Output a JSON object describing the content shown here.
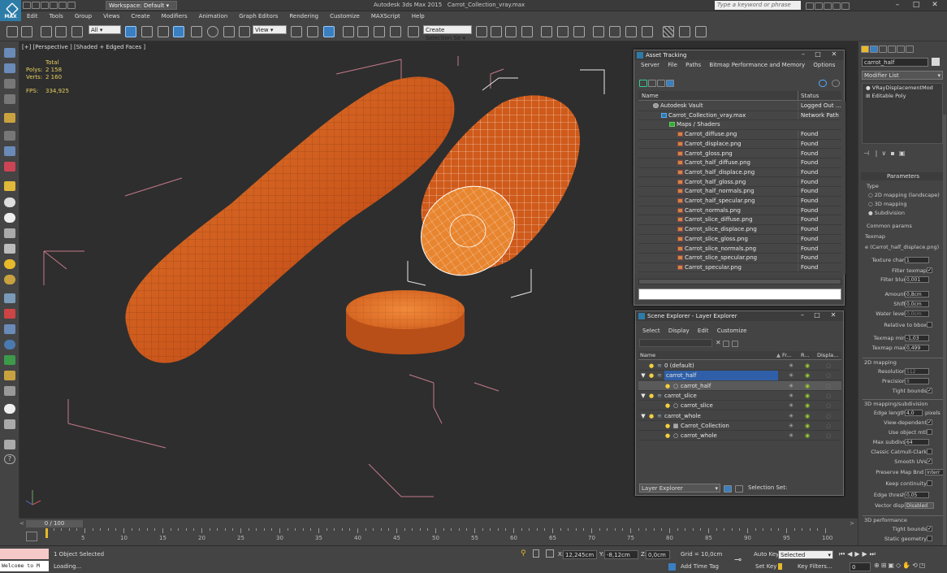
{
  "app": {
    "logo_label": "MAX",
    "title": "Autodesk 3ds Max 2015",
    "file": "Carrot_Collection_vray.max",
    "workspace": "Workspace: Default",
    "search_placeholder": "Type a keyword or phrase"
  },
  "menu": [
    "Edit",
    "Tools",
    "Group",
    "Views",
    "Create",
    "Modifiers",
    "Animation",
    "Graph Editors",
    "Rendering",
    "Customize",
    "MAXScript",
    "Help"
  ],
  "toolbar": {
    "selection_filter": "All",
    "ref_coord": "View",
    "named_selection": "Create Selection Se"
  },
  "viewport": {
    "label": "[+] [Perspective ] [Shaded + Edged Faces ]",
    "stats_total": "Total",
    "polys_label": "Polys:",
    "polys_value": "2 158",
    "verts_label": "Verts:",
    "verts_value": "2 160",
    "fps_label": "FPS:",
    "fps_value": "334,925"
  },
  "asset_tracking": {
    "title": "Asset Tracking",
    "menu": [
      "Server",
      "File",
      "Paths",
      "Bitmap Performance and Memory",
      "Options"
    ],
    "col_name": "Name",
    "col_status": "Status",
    "rows": [
      {
        "name": "Autodesk Vault",
        "status": "Logged Out ..."
      },
      {
        "name": "Carrot_Collection_vray.max",
        "status": "Network Path"
      },
      {
        "name": "Maps / Shaders",
        "status": ""
      },
      {
        "name": "Carrot_diffuse.png",
        "status": "Found"
      },
      {
        "name": "Carrot_displace.png",
        "status": "Found"
      },
      {
        "name": "Carrot_gloss.png",
        "status": "Found"
      },
      {
        "name": "Carrot_half_diffuse.png",
        "status": "Found"
      },
      {
        "name": "Carrot_half_displace.png",
        "status": "Found"
      },
      {
        "name": "Carrot_half_gloss.png",
        "status": "Found"
      },
      {
        "name": "Carrot_half_normals.png",
        "status": "Found"
      },
      {
        "name": "Carrot_half_specular.png",
        "status": "Found"
      },
      {
        "name": "Carrot_normals.png",
        "status": "Found"
      },
      {
        "name": "Carrot_slice_diffuse.png",
        "status": "Found"
      },
      {
        "name": "Carrot_slice_displace.png",
        "status": "Found"
      },
      {
        "name": "Carrot_slice_gloss.png",
        "status": "Found"
      },
      {
        "name": "Carrot_slice_normals.png",
        "status": "Found"
      },
      {
        "name": "Carrot_slice_specular.png",
        "status": "Found"
      },
      {
        "name": "Carrot_specular.png",
        "status": "Found"
      }
    ]
  },
  "scene_explorer": {
    "title": "Scene Explorer - Layer Explorer",
    "menu": [
      "Select",
      "Display",
      "Edit",
      "Customize"
    ],
    "col_name": "Name",
    "col_fr": "Fr...",
    "col_r": "R...",
    "col_disp": "Displa...",
    "rows": [
      {
        "name": "0 (default)",
        "type": "layer",
        "expanded": false,
        "selected": false
      },
      {
        "name": "carrot_half",
        "type": "layer",
        "expanded": true,
        "selected": true
      },
      {
        "name": "carrot_half",
        "type": "object",
        "expanded": false,
        "selected": false
      },
      {
        "name": "carrot_slice",
        "type": "layer",
        "expanded": true,
        "selected": false
      },
      {
        "name": "carrot_slice",
        "type": "object",
        "expanded": false,
        "selected": false
      },
      {
        "name": "carrot_whole",
        "type": "layer",
        "expanded": true,
        "selected": false
      },
      {
        "name": "Carrot_Collection",
        "type": "group",
        "expanded": false,
        "selected": false
      },
      {
        "name": "carrot_whole",
        "type": "object",
        "expanded": false,
        "selected": false
      }
    ],
    "footer_dropdown": "Layer Explorer",
    "selection_set_label": "Selection Set:"
  },
  "command_panel": {
    "object_name": "carrot_half",
    "modifier_list": "Modifier List",
    "stack": [
      "VRayDisplacementMod",
      "Editable Poly"
    ],
    "parameters_title": "Parameters",
    "type_label": "Type",
    "type_options": [
      "2D mapping (landscape)",
      "3D mapping",
      "Subdivision"
    ],
    "type_selected": "Subdivision",
    "common_params": "Common params",
    "texmap_label": "Texmap",
    "texmap_value": "e (Carrot_half_displace.png)",
    "texture_chan_label": "Texture chan",
    "texture_chan_value": "1",
    "filter_texmap_label": "Filter texmap",
    "filter_blur_label": "Filter blur",
    "filter_blur_value": "0,001",
    "amount_label": "Amount",
    "amount_value": "0,8cm",
    "shift_label": "Shift",
    "shift_value": "0,0cm",
    "water_level_label": "Water level",
    "water_level_value": "0,0cm",
    "relative_bbox_label": "Relative to bbox",
    "texmap_min_label": "Texmap min",
    "texmap_min_value": "-1,03",
    "texmap_max_label": "Texmap max",
    "texmap_max_value": "0,499",
    "mapping2d_title": "2D mapping",
    "resolution_label": "Resolution",
    "resolution_value": "512",
    "precision_label": "Precision",
    "precision_value": "8",
    "tight_bounds_label": "Tight bounds",
    "mapping3d_title": "3D mapping/subdivision",
    "edge_length_label": "Edge length",
    "edge_length_value": "4,0",
    "pixels_label": "pixels",
    "view_dependent_label": "View-dependent",
    "use_object_mtl_label": "Use object mtl",
    "max_subdivs_label": "Max subdivs",
    "max_subdivs_value": "64",
    "classic_cc_label": "Classic Catmull-Clark",
    "smooth_uvs_label": "Smooth UVs",
    "preserve_map_label": "Preserve Map Bnd",
    "preserve_map_value": "Interr",
    "keep_continuity_label": "Keep continuity",
    "edge_thresh_label": "Edge thresh",
    "edge_thresh_value": "0,05",
    "vector_displ_label": "Vector displ",
    "vector_displ_value": "Disabled",
    "performance_title": "3D performance",
    "tight_bounds2_label": "Tight bounds",
    "static_geometry_label": "Static geometry"
  },
  "timeline": {
    "frame_display": "0 / 100",
    "ticks": [
      "5",
      "10",
      "15",
      "20",
      "25",
      "30",
      "35",
      "40",
      "45",
      "50",
      "55",
      "60",
      "65",
      "70",
      "75",
      "80",
      "85",
      "90",
      "95",
      "100"
    ]
  },
  "status": {
    "maxscript": "Welcome to M",
    "objects_selected": "1 Object Selected",
    "loading": "Loading...",
    "x_label": "X:",
    "x_value": "12,245cm",
    "y_label": "Y:",
    "y_value": "-8,12cm",
    "z_label": "Z:",
    "z_value": "0,0cm",
    "grid": "Grid = 10,0cm",
    "add_time_tag": "Add Time Tag",
    "auto_key": "Auto Key",
    "auto_key_value": "Selected",
    "set_key": "Set Key",
    "key_filters": "Key Filters...",
    "frame_value": "0"
  }
}
